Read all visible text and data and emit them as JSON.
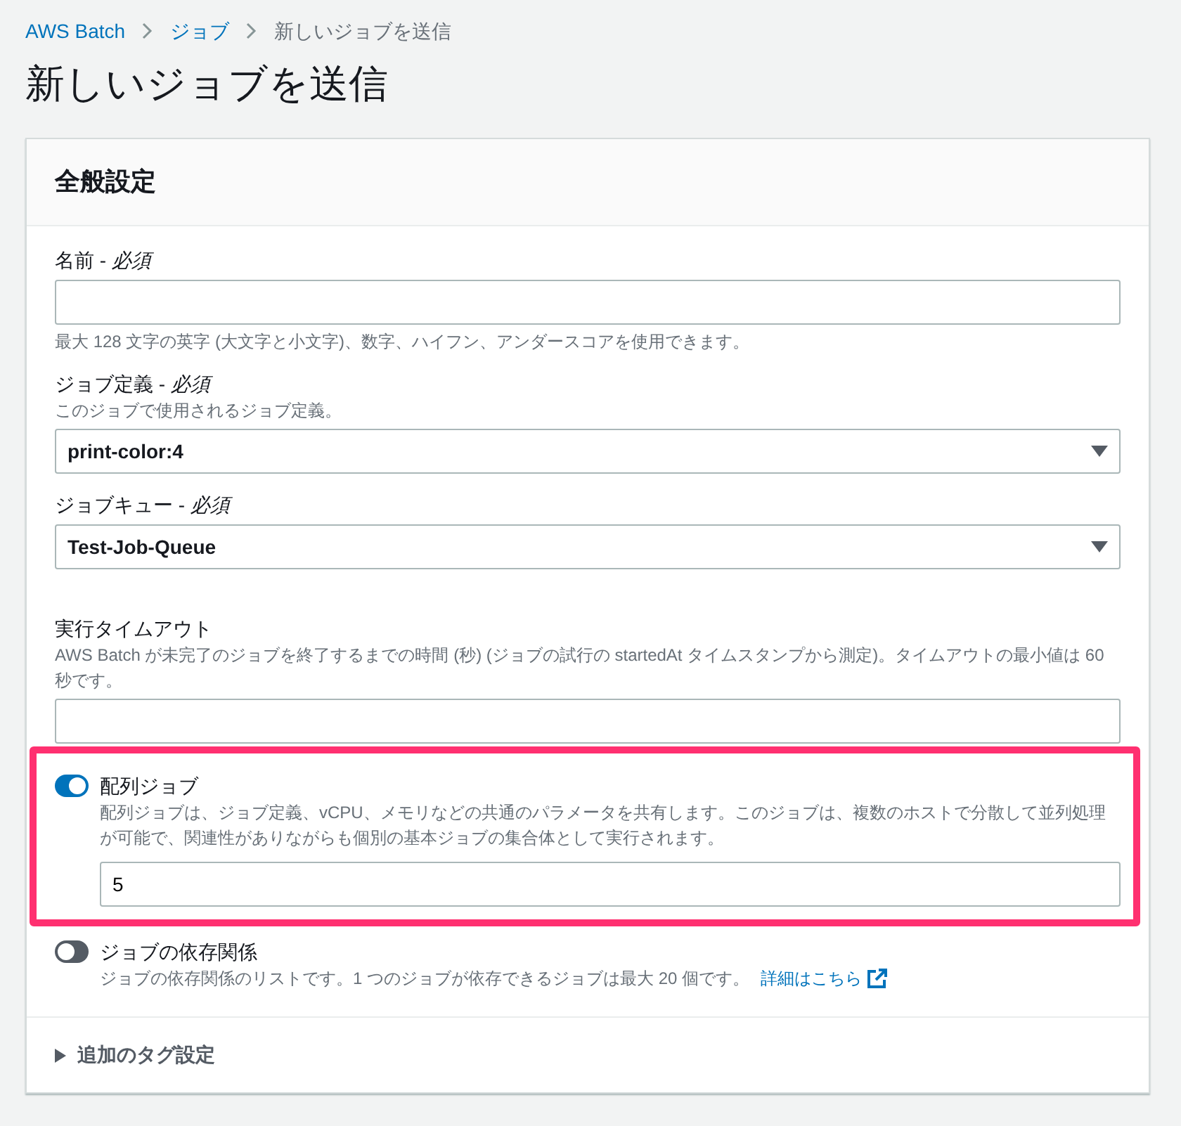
{
  "breadcrumbs": [
    {
      "label": "AWS Batch",
      "kind": "link"
    },
    {
      "label": "ジョブ",
      "kind": "link"
    },
    {
      "label": "新しいジョブを送信",
      "kind": "current"
    }
  ],
  "title": "新しいジョブを送信",
  "panel": {
    "title": "全般設定",
    "fields": [
      {
        "kind": "text",
        "label": "名前 - *必須*",
        "hint": "最大 128 文字の英字 (大文字と小文字)、数字、ハイフン、アンダースコアを使用できます。"
      },
      {
        "kind": "select",
        "label": "ジョブ定義 - *必須*",
        "description": "このジョブで使用されるジョブ定義。",
        "value": "print-color:4"
      },
      {
        "kind": "select",
        "label": "ジョブキュー - *必須*",
        "value": "Test-Job-Queue"
      },
      {
        "kind": "text",
        "label": "実行タイムアウト",
        "description": "AWS Batch が未完了のジョブを終了するまでの時間 (秒) (ジョブの試行の startedAt タイムスタンプから測定)。タイムアウトの最小値は 60 秒です。"
      }
    ],
    "toggles": [
      {
        "label": "配列ジョブ",
        "on": true,
        "highlighted": true,
        "description": "配列ジョブは、ジョブ定義、vCPU、メモリなどの共通のパラメータを共有します。このジョブは、複数のホストで分散して並列処理が可能で、関連性がありながらも個別の基本ジョブの集合体として実行されます。",
        "value": "5"
      },
      {
        "label": "ジョブの依存関係",
        "on": false,
        "highlighted": false,
        "description": "ジョブの依存関係のリストです。1 つのジョブが依存できるジョブは最大 20 個です。",
        "link": "詳細はこちら"
      }
    ],
    "section": {
      "label": "追加のタグ設定",
      "expanded": false
    }
  }
}
